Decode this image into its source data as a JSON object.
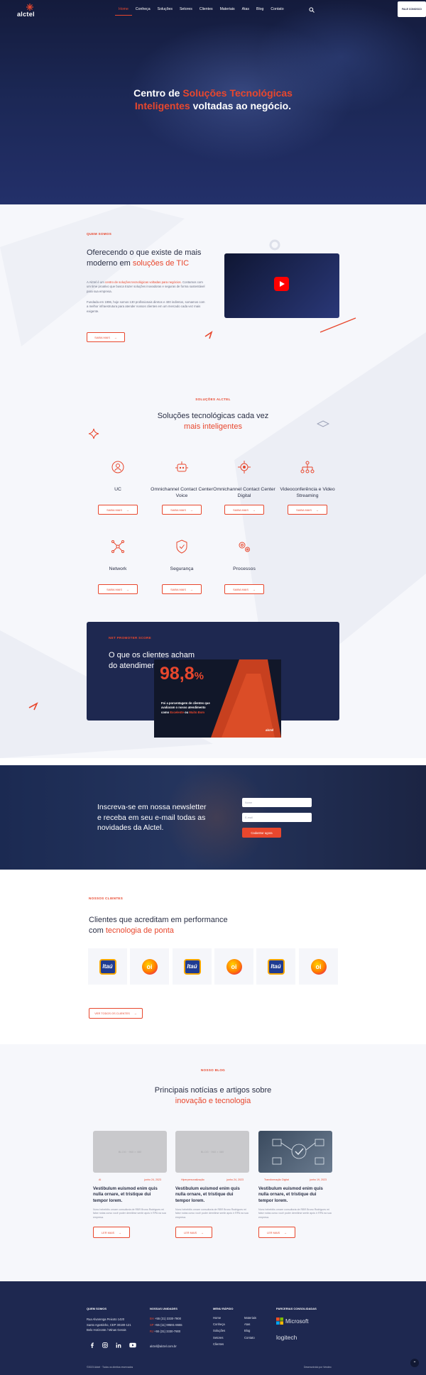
{
  "header": {
    "logo": "alctel",
    "nav": [
      "Home",
      "Conheça",
      "Soluções",
      "Setores",
      "Clientes",
      "Materiais",
      "Atas",
      "Blog",
      "Contato"
    ],
    "cta": "FALE CONOSCO"
  },
  "hero": {
    "t1": "Centro de ",
    "t2": "Soluções Tecnológicas",
    "t3": "Inteligentes",
    "t4": " voltadas ao negócio."
  },
  "about": {
    "eyebrow": "QUEM SOMOS",
    "h_a": "Oferecendo o que existe de mais",
    "h_b": "moderno em ",
    "h_c": "soluções de TIC",
    "p1a": "A Alctel é um ",
    "p1b": "centro de soluções tecnológicas voltadas para negócios.",
    "p1c": " Contamos com um time proativo que busca trazer soluções inovadoras e seguras de forma sustentável para sua empresa.",
    "p2": "Fundada em 1996, hoje somos 130 profissionais diretos e 400 indiretos, somamos com a melhor infraestrutura para atender nossos clientes em um mercado cada vez mais exigente.",
    "btn": "SAIBA MAIS"
  },
  "solutions": {
    "eyebrow": "SOLUÇÕES ALCTEL",
    "h_a": "Soluções tecnológicas cada vez",
    "h_b": "mais inteligentes",
    "items": [
      {
        "label": "UC",
        "btn": "SAIBA MAIS",
        "icon": "user-shield-icon"
      },
      {
        "label": "Omnichannel Contact Center Voice",
        "btn": "SAIBA MAIS",
        "icon": "robot-icon"
      },
      {
        "label": "Omnichannel Contact Center Digital",
        "btn": "SAIBA MAIS",
        "icon": "chip-icon"
      },
      {
        "label": "Videoconferência e Video Streaming",
        "btn": "SAIBA MAIS",
        "icon": "network-tree-icon"
      },
      {
        "label": "Network",
        "btn": "SAIBA MAIS",
        "icon": "network-icon"
      },
      {
        "label": "Segurança",
        "btn": "SAIBA MAIS",
        "icon": "shield-icon"
      },
      {
        "label": "Processos",
        "btn": "SAIBA MAIS",
        "icon": "gears-icon"
      }
    ]
  },
  "nps": {
    "eyebrow": "NET PROMOTER SCORE",
    "h_a": "O que os clientes acham",
    "h_b": "do atendimento da Alctel",
    "value": "98,8",
    "pct": "%",
    "caption_a": "Foi a porcentagem de clientes que",
    "caption_b": "avaliaram o nosso atendimento",
    "caption_c": "como ",
    "caption_d": "Excelente",
    "caption_e": " ou ",
    "caption_f": "Muito Bom",
    "brand": "alctel"
  },
  "newsletter": {
    "h_a": "Inscreva-se em nossa newsletter",
    "h_b": "e receba em seu e-mail todas as",
    "h_c": "novidades da Alctel.",
    "name_ph": "Nome",
    "email_ph": "E-mail",
    "btn": "Cadastrar agora"
  },
  "clients": {
    "eyebrow": "NOSSOS CLIENTES",
    "h_a": "Clientes que acreditam em performance",
    "h_b": "com ",
    "h_c": "tecnologia de ponta",
    "logos": [
      "Itaú",
      "oi",
      "Itaú",
      "oi",
      "Itaú",
      "oi"
    ],
    "btn": "VER TODOS OS CLIENTES"
  },
  "blog": {
    "eyebrow": "NOSSO BLOG",
    "h_a": "Principais notícias e artigos sobre",
    "h_b": "inovação e tecnologia",
    "posts": [
      {
        "thumb": "BLOG · 960 × 480",
        "cat": "AI",
        "date": "junho 24, 2023",
        "title": "Vestibulum euismod enim quis nulla ornare, et tristique dui tempor lorem.",
        "excerpt": "Nunc hebebitis ornare consultoria de RBR Bruno Rodrigues mi false notas curso você poder demitirse sentir após ir RPA na sua empresa.",
        "btn": "LER MAIS"
      },
      {
        "thumb": "BLOG · 960 × 480",
        "cat": "Hiperpersonalização",
        "date": "junho 24, 2023",
        "title": "Vestibulum euismod enim quis nulla ornare, et tristique dui tempor lorem.",
        "excerpt": "Nunc hebebitis ornare consultoria de RBR Bruno Rodrigues mi false notas curso você poder demitirse sentir após ir RPA na sua empresa.",
        "btn": "LER MAIS"
      },
      {
        "thumb": "",
        "cat": "Transformação Digital",
        "date": "junho 19, 2023",
        "title": "Vestibulum euismod enim quis nulla ornare, et tristique dui tempor lorem.",
        "excerpt": "Nunc hebebitis ornare consultoria de RBR Bruno Rodrigues mi false notas curso você poder demitirse sentir após ir RPA na sua empresa.",
        "btn": "LER MAIS"
      }
    ]
  },
  "footer": {
    "col1_title": "QUEM SOMOS",
    "address": [
      "Rua Alvarenga Peixoto 1420",
      "Santo Agostinho, CEP 30180-121",
      "Belo Horizonte / Minas Gerais"
    ],
    "col2_title": "NOSSAS UNIDADES",
    "units": [
      {
        "city": "BH",
        "phone": "+55 (31) 3330-7900"
      },
      {
        "city": "SP",
        "phone": "+55 (11) 99591-8655"
      },
      {
        "city": "RJ",
        "phone": "+55 (31) 3330-7900"
      }
    ],
    "email": "alctel@alctel.com.br",
    "col3_title": "MENU RÁPIDO",
    "menu_a": [
      "Home",
      "Conheça",
      "Soluções",
      "Setores",
      "Clientes"
    ],
    "menu_b": [
      "Materiais",
      "Atas",
      "Blog",
      "Contato"
    ],
    "col4_title": "PARCERIAS CONSOLIDADAS",
    "partners": [
      "Microsoft",
      "logitech"
    ],
    "copyright": "©2023 Alctel · Todos os direitos reservados",
    "dev": "Desenvolvido por Vendeo",
    "colors": {
      "accent": "#e8472d",
      "navy": "#1e2850"
    }
  }
}
